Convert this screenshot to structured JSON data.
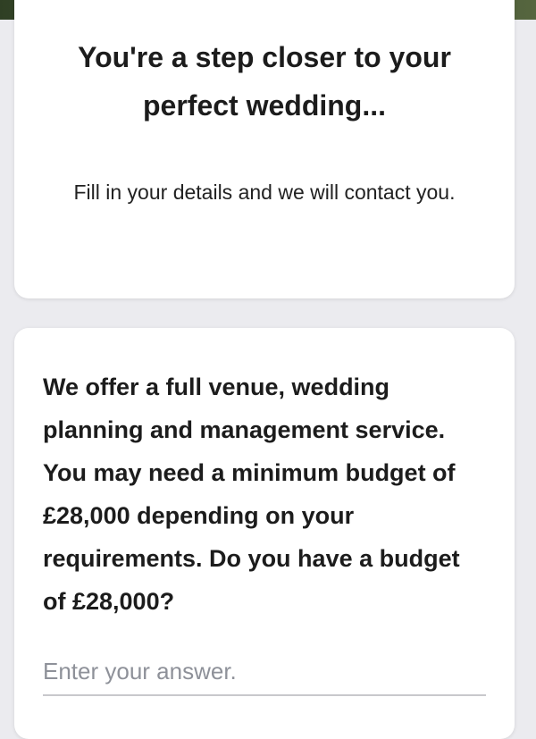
{
  "intro": {
    "title": "You're a step closer to your perfect wedding...",
    "subtitle": "Fill in your details and we will contact you."
  },
  "question": {
    "text": "We offer a full venue, wedding planning and management service. You may need a minimum budget of £28,000 depending on your requirements. Do you have a budget of £28,000?",
    "answer_placeholder": "Enter your answer.",
    "answer_value": ""
  }
}
